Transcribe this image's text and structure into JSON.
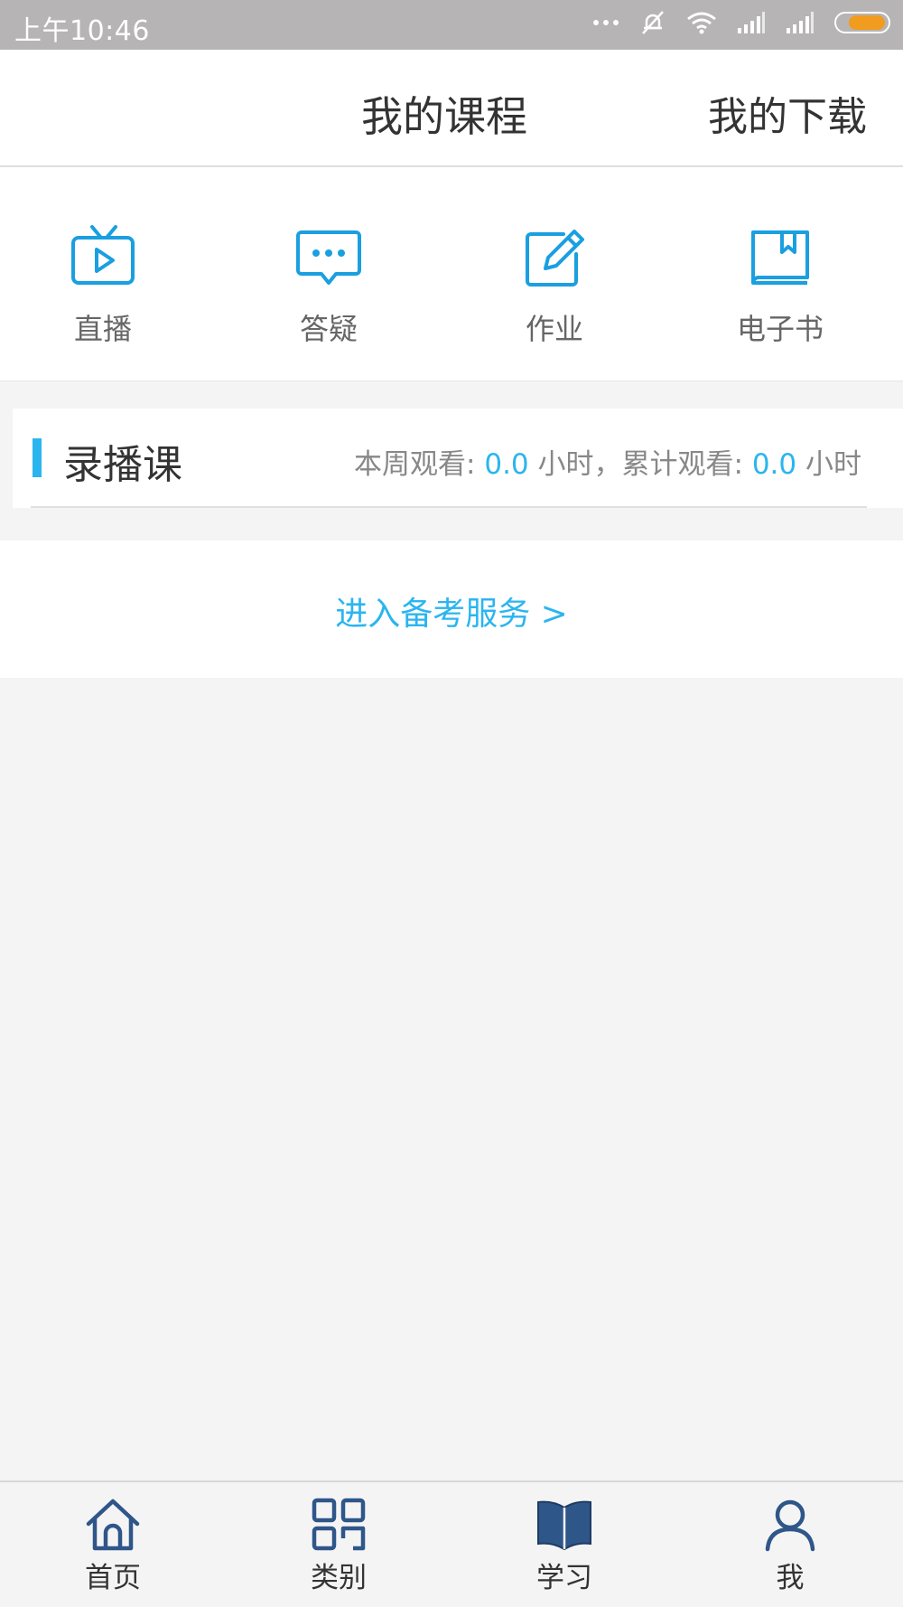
{
  "status_bar": {
    "time": "上午10:46",
    "icons": [
      "more-dots-icon",
      "mute-bell-icon",
      "wifi-icon",
      "signal-icon",
      "signal-icon",
      "battery-icon"
    ],
    "battery_color": "#f29c1f"
  },
  "header": {
    "title": "我的课程",
    "right_action": "我的下载"
  },
  "quick_actions": [
    {
      "label": "直播",
      "icon": "tv-play-icon"
    },
    {
      "label": "答疑",
      "icon": "chat-bubble-icon"
    },
    {
      "label": "作业",
      "icon": "edit-note-icon"
    },
    {
      "label": "电子书",
      "icon": "ebook-icon"
    }
  ],
  "recorded": {
    "title": "录播课",
    "week_label": "本周观看: ",
    "week_value": "0.0",
    "unit1": " 小时，累计观看: ",
    "total_value": "0.0",
    "unit2": " 小时"
  },
  "service_link": "进入备考服务 >",
  "tabbar": [
    {
      "label": "首页",
      "icon": "home-icon"
    },
    {
      "label": "类别",
      "icon": "category-grid-icon"
    },
    {
      "label": "学习",
      "icon": "open-book-icon",
      "active": true
    },
    {
      "label": "我",
      "icon": "user-icon"
    }
  ],
  "colors": {
    "accent": "#2bb5ef",
    "icon_blue": "#1a9fe0",
    "tab_icon": "#2f5689",
    "background": "#f4f4f5"
  }
}
